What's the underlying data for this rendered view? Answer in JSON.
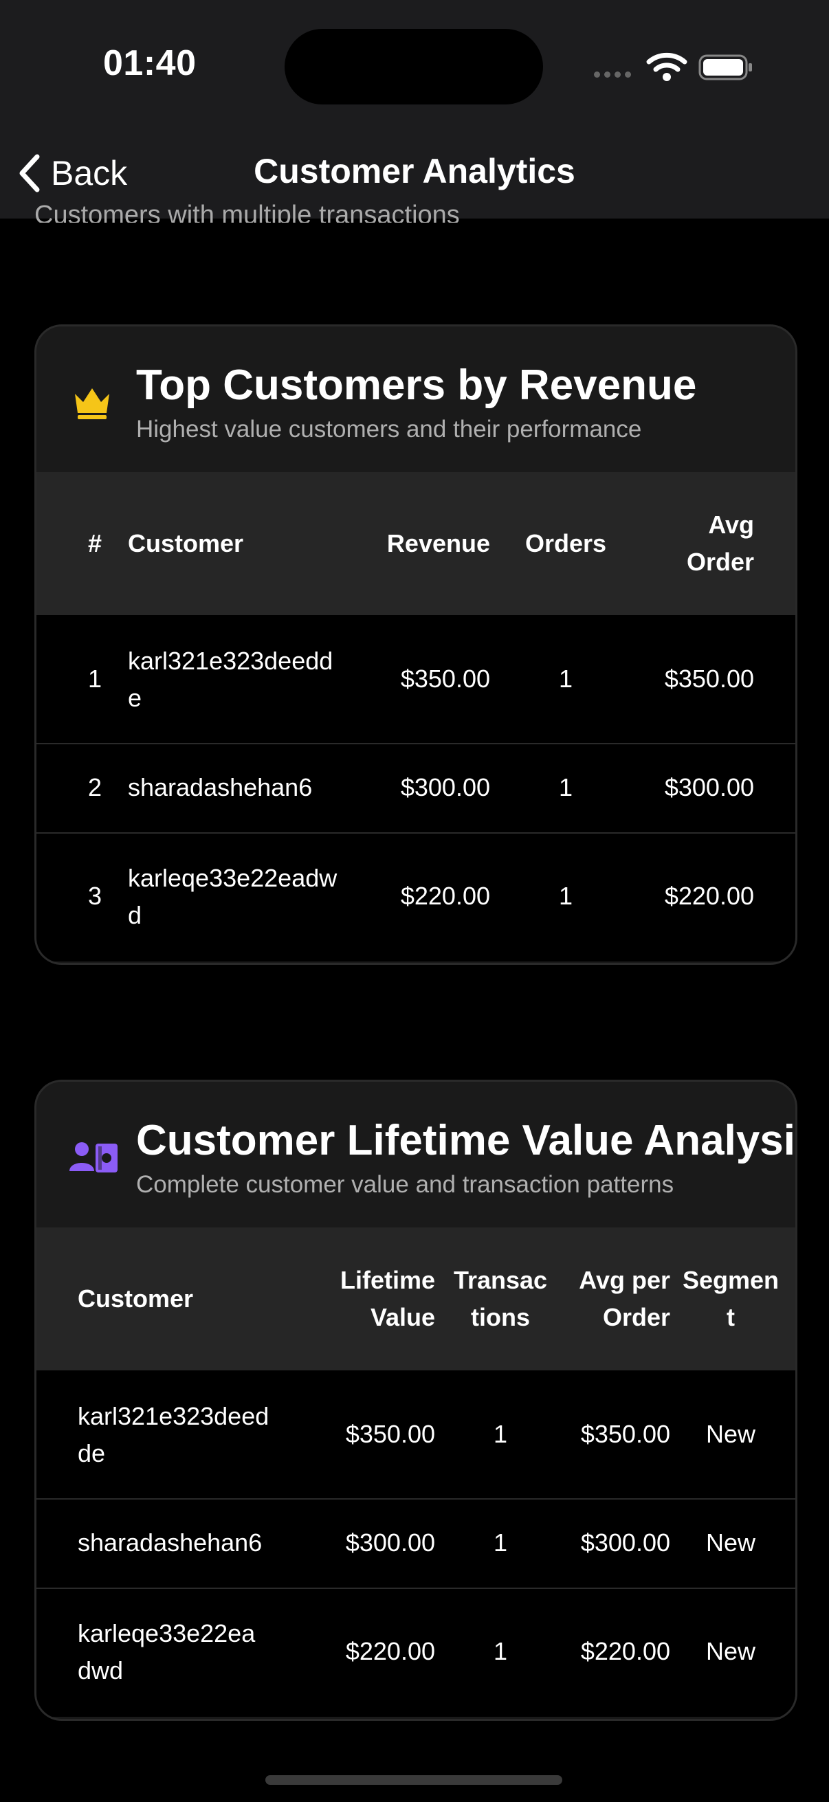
{
  "status": {
    "time": "01:40"
  },
  "nav": {
    "back_label": "Back",
    "title": "Customer Analytics"
  },
  "scrolled_text": "Customers with multiple transactions",
  "top_customers": {
    "title": "Top Customers by Revenue",
    "subtitle": "Highest value customers and their performance",
    "columns": [
      "#",
      "Customer",
      "Revenue",
      "Orders",
      "Avg\nOrder"
    ],
    "rows": [
      {
        "rank": "1",
        "customer": "karl321e323deedd\ne",
        "revenue": "$350.00",
        "orders": "1",
        "avg_order": "$350.00"
      },
      {
        "rank": "2",
        "customer": "sharadashehan6",
        "revenue": "$300.00",
        "orders": "1",
        "avg_order": "$300.00"
      },
      {
        "rank": "3",
        "customer": "karleqe33e22eadw\nd",
        "revenue": "$220.00",
        "orders": "1",
        "avg_order": "$220.00"
      }
    ]
  },
  "lifetime_value": {
    "title": "Customer Lifetime Value Analysis",
    "subtitle": "Complete customer value and transaction patterns",
    "columns": [
      "Customer",
      "Lifetime\nValue",
      "Transac\ntions",
      "Avg per\nOrder",
      "Segmen\nt"
    ],
    "rows": [
      {
        "customer": "karl321e323deed\nde",
        "lifetime_value": "$350.00",
        "transactions": "1",
        "avg_per_order": "$350.00",
        "segment": "New"
      },
      {
        "customer": "sharadashehan6",
        "lifetime_value": "$300.00",
        "transactions": "1",
        "avg_per_order": "$300.00",
        "segment": "New"
      },
      {
        "customer": "karleqe33e22ea\ndwd",
        "lifetime_value": "$220.00",
        "transactions": "1",
        "avg_per_order": "$220.00",
        "segment": "New"
      }
    ]
  },
  "icons": {
    "crown": "crown-icon",
    "lifetime": "customer-card-icon",
    "back": "chevron-left-icon"
  },
  "colors": {
    "crown": "#f5c518",
    "lifetime_icon": "#8b5cf6",
    "background": "#000000",
    "card": "#1a1a1a"
  }
}
